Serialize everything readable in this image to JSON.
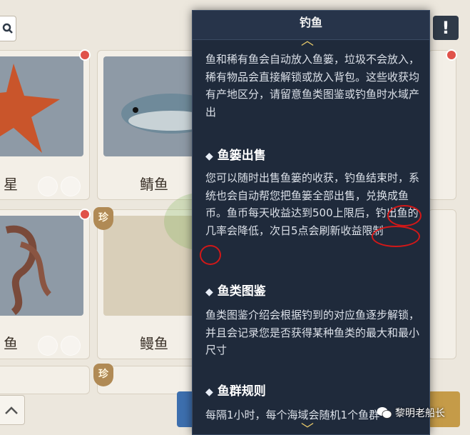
{
  "popup": {
    "title": "钓鱼",
    "intro": "鱼和稀有鱼会自动放入鱼篓，垃圾不会放入，稀有物品会直接解锁或放入背包。这些收获均有产地区分，请留意鱼类图鉴或钓鱼时水域产出",
    "sections": [
      {
        "heading": "鱼篓出售",
        "body": "您可以随时出售鱼篓的收获，钓鱼结束时，系统也会自动帮您把鱼篓全部出售，兑换成鱼币。鱼币每天收益达到500上限后，钓出鱼的几率会降低，次日5点会刷新收益限制"
      },
      {
        "heading": "鱼类图鉴",
        "body": "鱼类图鉴介绍会根据钓到的对应鱼逐步解锁，并且会记录您是否获得某种鱼类的最大和最小尺寸"
      },
      {
        "heading": "鱼群规则",
        "body": "每隔1小时，每个海域会随机1个鱼群"
      }
    ]
  },
  "cards": [
    {
      "name": "星"
    },
    {
      "name": "鲭鱼"
    },
    {
      "name": "鱼"
    },
    {
      "name": "鳗鱼"
    }
  ],
  "rare_badge": "珍",
  "alert_label": "!",
  "watermark": "黎明老船长",
  "colors": {
    "popup_bg": "#1f2a3b",
    "accent": "#e7c96a",
    "annotation": "#d21818"
  }
}
